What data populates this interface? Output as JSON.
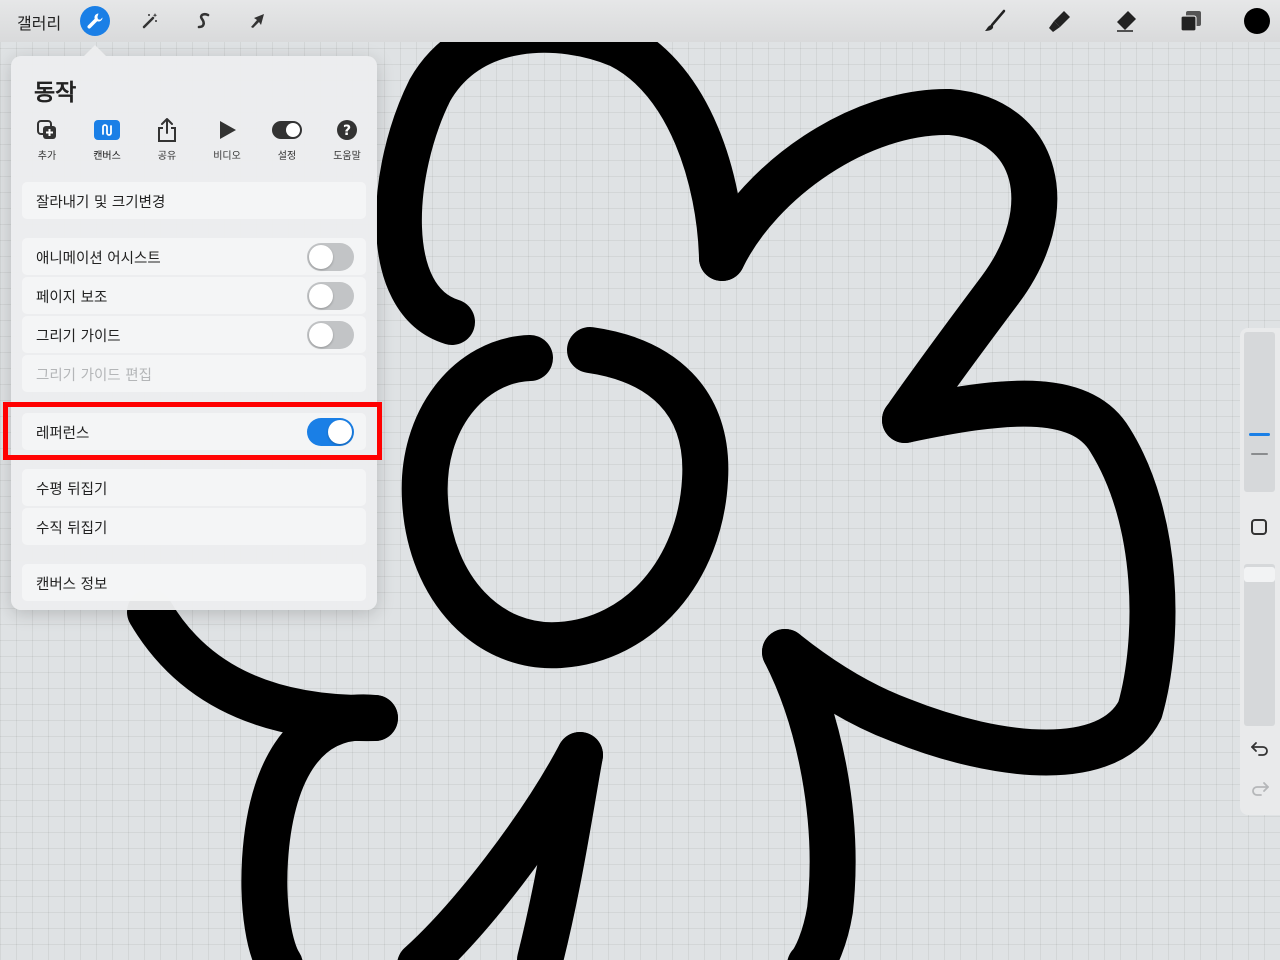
{
  "topbar": {
    "gallery_label": "갤러리",
    "tools": [
      "wrench-icon",
      "magic-wand-icon",
      "selection-s-icon",
      "transform-arrow-icon"
    ],
    "right_tools": [
      "brush-icon",
      "smudge-icon",
      "eraser-icon",
      "layers-icon",
      "color-swatch"
    ],
    "color": "#000000"
  },
  "panel": {
    "title": "동작",
    "tabs": [
      {
        "label": "추가",
        "icon": "add-icon"
      },
      {
        "label": "캔버스",
        "icon": "canvas-icon",
        "active": true
      },
      {
        "label": "공유",
        "icon": "share-icon"
      },
      {
        "label": "비디오",
        "icon": "play-icon"
      },
      {
        "label": "설정",
        "icon": "toggle-settings-icon"
      },
      {
        "label": "도움말",
        "icon": "help-icon"
      }
    ],
    "items": {
      "crop_resize": "잘라내기 및 크기변경",
      "animation_assist": "애니메이션 어시스트",
      "page_assist": "페이지 보조",
      "drawing_guide": "그리기 가이드",
      "edit_drawing_guide": "그리기 가이드 편집",
      "reference": "레퍼런스",
      "flip_horizontal": "수평 뒤집기",
      "flip_vertical": "수직 뒤집기",
      "canvas_info": "캔버스 정보"
    },
    "toggles": {
      "animation_assist": false,
      "page_assist": false,
      "drawing_guide": false,
      "reference": true
    }
  },
  "colors": {
    "accent": "#1a7fe6",
    "highlight": "#ff0000"
  }
}
